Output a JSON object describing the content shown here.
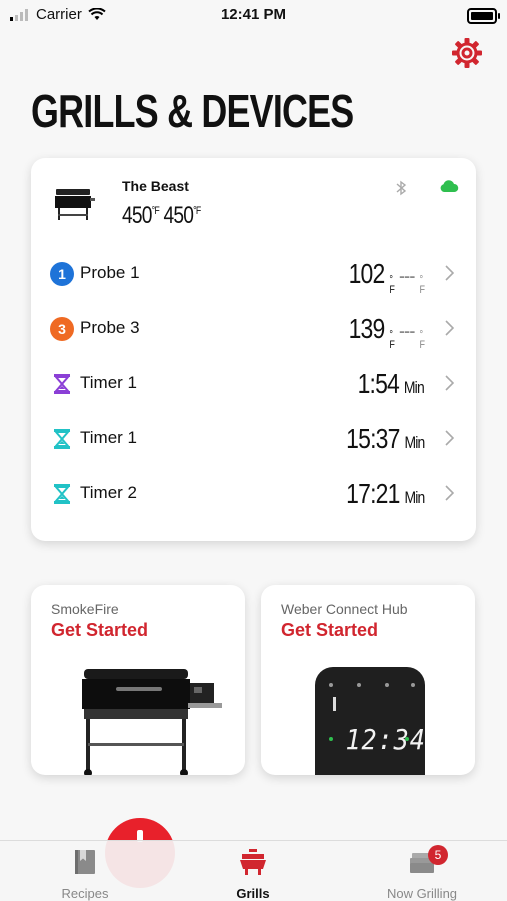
{
  "status_bar": {
    "carrier": "Carrier",
    "time": "12:41 PM"
  },
  "page": {
    "title": "GRILLS & DEVICES"
  },
  "device": {
    "name": "The Beast",
    "temp_1": "450",
    "temp_2": "450",
    "temp_unit": "F",
    "icons": [
      "bluetooth-icon",
      "cloud-icon"
    ],
    "cloud_color": "#2fbf4f"
  },
  "rows": [
    {
      "label": "Probe 1",
      "badge": "1",
      "badge_color": "#1e73d8",
      "value": "102",
      "unit": "F",
      "target": "---"
    },
    {
      "label": "Probe 3",
      "badge": "3",
      "badge_color": "#ef6a23",
      "value": "139",
      "unit": "F",
      "target": "---"
    },
    {
      "label": "Timer 1",
      "icon_color": "#8b3fd6",
      "value": "1:54",
      "unit": "Min"
    },
    {
      "label": "Timer 1",
      "icon_color": "#21c2c6",
      "value": "15:37",
      "unit": "Min"
    },
    {
      "label": "Timer 2",
      "icon_color": "#21c2c6",
      "value": "17:21",
      "unit": "Min"
    }
  ],
  "promos": [
    {
      "caption": "SmokeFire",
      "title": "Get Started"
    },
    {
      "caption": "Weber Connect Hub",
      "title": "Get Started",
      "display_time": "12:34"
    }
  ],
  "tabs": [
    {
      "label": "Recipes",
      "active": false
    },
    {
      "label": "Grills",
      "active": true
    },
    {
      "label": "Now Grilling",
      "active": false,
      "badge": "5"
    }
  ],
  "colors": {
    "accent": "#d1262f"
  }
}
